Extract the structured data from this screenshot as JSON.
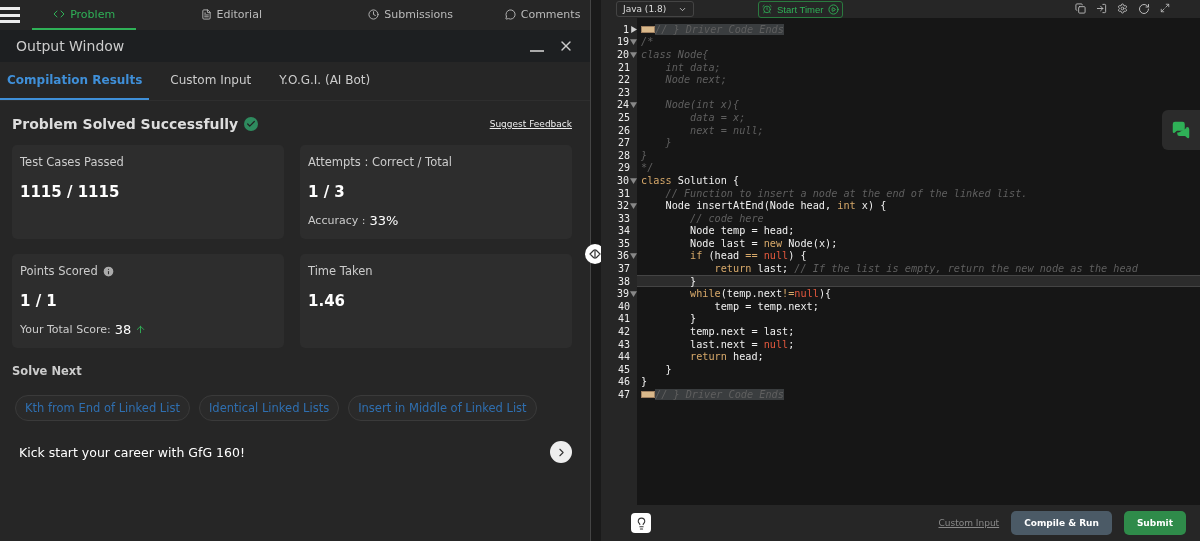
{
  "nav": {
    "tabs": [
      {
        "label": "Problem",
        "selected": true
      },
      {
        "label": "Editorial",
        "selected": false
      },
      {
        "label": "Submissions",
        "selected": false
      },
      {
        "label": "Comments",
        "selected": false
      }
    ]
  },
  "output": {
    "title": "Output Window",
    "tabs": [
      {
        "label": "Compilation Results",
        "selected": true
      },
      {
        "label": "Custom Input",
        "selected": false
      },
      {
        "label": "Y.O.G.I. (AI Bot)",
        "selected": false
      }
    ],
    "status": "Problem Solved Successfully",
    "feedback": "Suggest Feedback",
    "cards": [
      {
        "title": "Test Cases Passed",
        "value": "1115 / 1115",
        "info": false
      },
      {
        "title": "Attempts : Correct / Total",
        "value": "1 / 3",
        "note_label": "Accuracy :",
        "note_value": "33%",
        "info": false
      },
      {
        "title": "Points Scored",
        "info": true,
        "value": "1 / 1",
        "note_label": "Your Total Score:",
        "note_value": "38",
        "trend_up": true
      },
      {
        "title": "Time Taken",
        "value": "1.46",
        "info": false
      }
    ],
    "solve_next": {
      "title": "Solve Next",
      "items": [
        "Kth from End of Linked List",
        "Identical Linked Lists",
        "Insert in Middle of Linked List"
      ]
    },
    "promo": "Kick start your career with GfG 160!"
  },
  "editor": {
    "language": "Java (1.8)",
    "timer": "Start Timer",
    "lines": [
      {
        "num": "1",
        "foldable": true,
        "folded": true,
        "current": false,
        "shaded": true,
        "tokens": [
          {
            "kind": "comment",
            "text": "// } Driver Code Ends"
          }
        ]
      },
      {
        "num": "19",
        "foldable": true,
        "folded": false,
        "current": false,
        "shaded": false,
        "tokens": [
          {
            "kind": "comment",
            "text": "/*"
          }
        ]
      },
      {
        "num": "20",
        "foldable": true,
        "folded": false,
        "current": false,
        "shaded": false,
        "tokens": [
          {
            "kind": "comment",
            "text": "class Node{"
          }
        ]
      },
      {
        "num": "21",
        "foldable": false,
        "current": false,
        "shaded": false,
        "tokens": [
          {
            "kind": "comment",
            "text": "    int data;"
          }
        ]
      },
      {
        "num": "22",
        "foldable": false,
        "current": false,
        "shaded": false,
        "tokens": [
          {
            "kind": "comment",
            "text": "    Node next;"
          }
        ]
      },
      {
        "num": "23",
        "foldable": false,
        "current": false,
        "shaded": false
      },
      {
        "num": "24",
        "foldable": true,
        "folded": false,
        "current": false,
        "shaded": false,
        "tokens": [
          {
            "kind": "comment",
            "text": "    Node(int x){"
          }
        ]
      },
      {
        "num": "25",
        "foldable": false,
        "current": false,
        "shaded": false,
        "tokens": [
          {
            "kind": "comment",
            "text": "        data = x;"
          }
        ]
      },
      {
        "num": "26",
        "foldable": false,
        "current": false,
        "shaded": false,
        "tokens": [
          {
            "kind": "comment",
            "text": "        next = null;"
          }
        ]
      },
      {
        "num": "27",
        "foldable": false,
        "current": false,
        "shaded": false,
        "tokens": [
          {
            "kind": "comment",
            "text": "    }"
          }
        ]
      },
      {
        "num": "28",
        "foldable": false,
        "current": false,
        "shaded": false,
        "tokens": [
          {
            "kind": "comment",
            "text": "}"
          }
        ]
      },
      {
        "num": "29",
        "foldable": false,
        "current": false,
        "shaded": false,
        "tokens": [
          {
            "kind": "comment",
            "text": "*/"
          }
        ]
      },
      {
        "num": "30",
        "foldable": true,
        "folded": false,
        "current": false,
        "shaded": false,
        "tokens": [
          {
            "kind": "keyword",
            "text": "class"
          },
          {
            "kind": "plain",
            "text": " Solution {"
          }
        ]
      },
      {
        "num": "31",
        "foldable": false,
        "current": false,
        "shaded": false,
        "tokens": [
          {
            "kind": "comment",
            "text": "    // Function to insert a node at the end of the linked list."
          }
        ]
      },
      {
        "num": "32",
        "foldable": true,
        "folded": false,
        "current": false,
        "shaded": false,
        "tokens": [
          {
            "kind": "plain",
            "text": "    Node insertAtEnd(Node head, "
          },
          {
            "kind": "keyword",
            "text": "int"
          },
          {
            "kind": "plain",
            "text": " x) {"
          }
        ]
      },
      {
        "num": "33",
        "foldable": false,
        "current": false,
        "shaded": false,
        "tokens": [
          {
            "kind": "comment",
            "text": "        // code here"
          }
        ]
      },
      {
        "num": "34",
        "foldable": false,
        "current": false,
        "shaded": false,
        "tokens": [
          {
            "kind": "plain",
            "text": "        Node temp = head;"
          }
        ]
      },
      {
        "num": "35",
        "foldable": false,
        "current": false,
        "shaded": false,
        "tokens": [
          {
            "kind": "plain",
            "text": "        Node last = "
          },
          {
            "kind": "keyword",
            "text": "new"
          },
          {
            "kind": "plain",
            "text": " Node(x);"
          }
        ]
      },
      {
        "num": "36",
        "foldable": true,
        "folded": false,
        "current": false,
        "shaded": false,
        "tokens": [
          {
            "kind": "keyword",
            "text": "        if"
          },
          {
            "kind": "plain",
            "text": " (head "
          },
          {
            "kind": "keyword",
            "text": "=="
          },
          {
            "kind": "null",
            "text": " null"
          },
          {
            "kind": "plain",
            "text": ") {"
          }
        ]
      },
      {
        "num": "37",
        "foldable": false,
        "current": false,
        "shaded": false,
        "tokens": [
          {
            "kind": "keyword",
            "text": "            return"
          },
          {
            "kind": "plain",
            "text": " last; "
          },
          {
            "kind": "comment",
            "text": "// If the list is empty, return the new node as the head"
          }
        ]
      },
      {
        "num": "38",
        "foldable": false,
        "current": true,
        "shaded": false,
        "tokens": [
          {
            "kind": "plain",
            "text": "        }"
          }
        ]
      },
      {
        "num": "39",
        "foldable": true,
        "folded": false,
        "current": false,
        "shaded": false,
        "tokens": [
          {
            "kind": "keyword",
            "text": "        while"
          },
          {
            "kind": "plain",
            "text": "(temp.next"
          },
          {
            "kind": "keyword",
            "text": "!="
          },
          {
            "kind": "null",
            "text": "null"
          },
          {
            "kind": "plain",
            "text": "){"
          }
        ]
      },
      {
        "num": "40",
        "foldable": false,
        "current": false,
        "shaded": false,
        "tokens": [
          {
            "kind": "plain",
            "text": "            temp = temp.next;"
          }
        ]
      },
      {
        "num": "41",
        "foldable": false,
        "current": false,
        "shaded": false,
        "tokens": [
          {
            "kind": "plain",
            "text": "        }"
          }
        ]
      },
      {
        "num": "42",
        "foldable": false,
        "current": false,
        "shaded": false,
        "tokens": [
          {
            "kind": "plain",
            "text": "        temp.next = last;"
          }
        ]
      },
      {
        "num": "43",
        "foldable": false,
        "current": false,
        "shaded": false,
        "tokens": [
          {
            "kind": "plain",
            "text": "        last.next = "
          },
          {
            "kind": "null",
            "text": "null"
          },
          {
            "kind": "plain",
            "text": ";"
          }
        ]
      },
      {
        "num": "44",
        "foldable": false,
        "current": false,
        "shaded": false,
        "tokens": [
          {
            "kind": "keyword",
            "text": "        return"
          },
          {
            "kind": "plain",
            "text": " head;"
          }
        ]
      },
      {
        "num": "45",
        "foldable": false,
        "current": false,
        "shaded": false,
        "tokens": [
          {
            "kind": "plain",
            "text": "    }"
          }
        ]
      },
      {
        "num": "46",
        "foldable": false,
        "current": false,
        "shaded": false,
        "tokens": [
          {
            "kind": "plain",
            "text": "}"
          }
        ]
      },
      {
        "num": "47",
        "foldable": false,
        "current": false,
        "shaded": true,
        "tokens": [
          {
            "kind": "comment",
            "text": "// } Driver Code Ends"
          }
        ]
      }
    ],
    "footer": {
      "custom_input": "Custom Input",
      "compile": "Compile & Run",
      "submit": "Submit"
    }
  }
}
